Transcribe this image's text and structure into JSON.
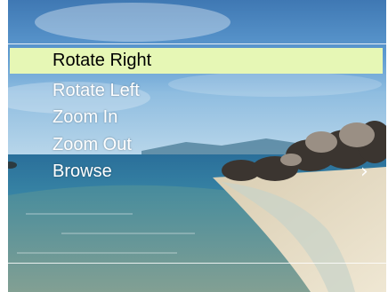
{
  "menu": {
    "items": [
      {
        "label": "Rotate Right",
        "selected": true
      },
      {
        "label": "Rotate Left",
        "selected": false
      },
      {
        "label": "Zoom In",
        "selected": false
      },
      {
        "label": "Zoom Out",
        "selected": false
      },
      {
        "label": "Browse",
        "selected": false
      }
    ],
    "highlight_color": "#e6f7b5"
  },
  "more_indicator": {
    "icon": "chevron-right-icon",
    "glyph": "›"
  },
  "background": {
    "image": "beach-photo"
  }
}
